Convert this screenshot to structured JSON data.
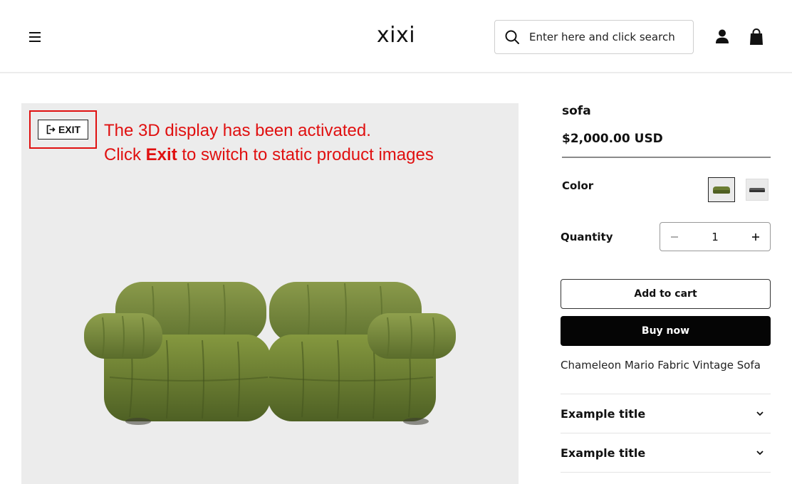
{
  "header": {
    "logo": "xixi",
    "search": {
      "placeholder": "Enter here and click search",
      "value": ""
    },
    "icons": [
      "hamburger-menu-icon",
      "search-icon",
      "account-icon",
      "shopping-bag-icon"
    ]
  },
  "viewer": {
    "exit_label": "EXIT",
    "notice_line1": "The 3D display has been activated.",
    "notice_line2_pre": "Click ",
    "notice_line2_bold": "Exit",
    "notice_line2_post": " to switch to static product images",
    "notice_color": "#e01010",
    "background": "#ececec"
  },
  "product": {
    "title": "sofa",
    "price": "$2,000.00 USD",
    "color_label": "Color",
    "color_swatches": [
      {
        "name": "green",
        "selected": true
      },
      {
        "name": "gray",
        "selected": false
      }
    ],
    "quantity_label": "Quantity",
    "quantity_value": "1",
    "add_to_cart": "Add to cart",
    "buy_now": "Buy now",
    "description": "Chameleon Mario Fabric Vintage Sofa",
    "accordions": [
      {
        "title": "Example title"
      },
      {
        "title": "Example title"
      }
    ]
  }
}
